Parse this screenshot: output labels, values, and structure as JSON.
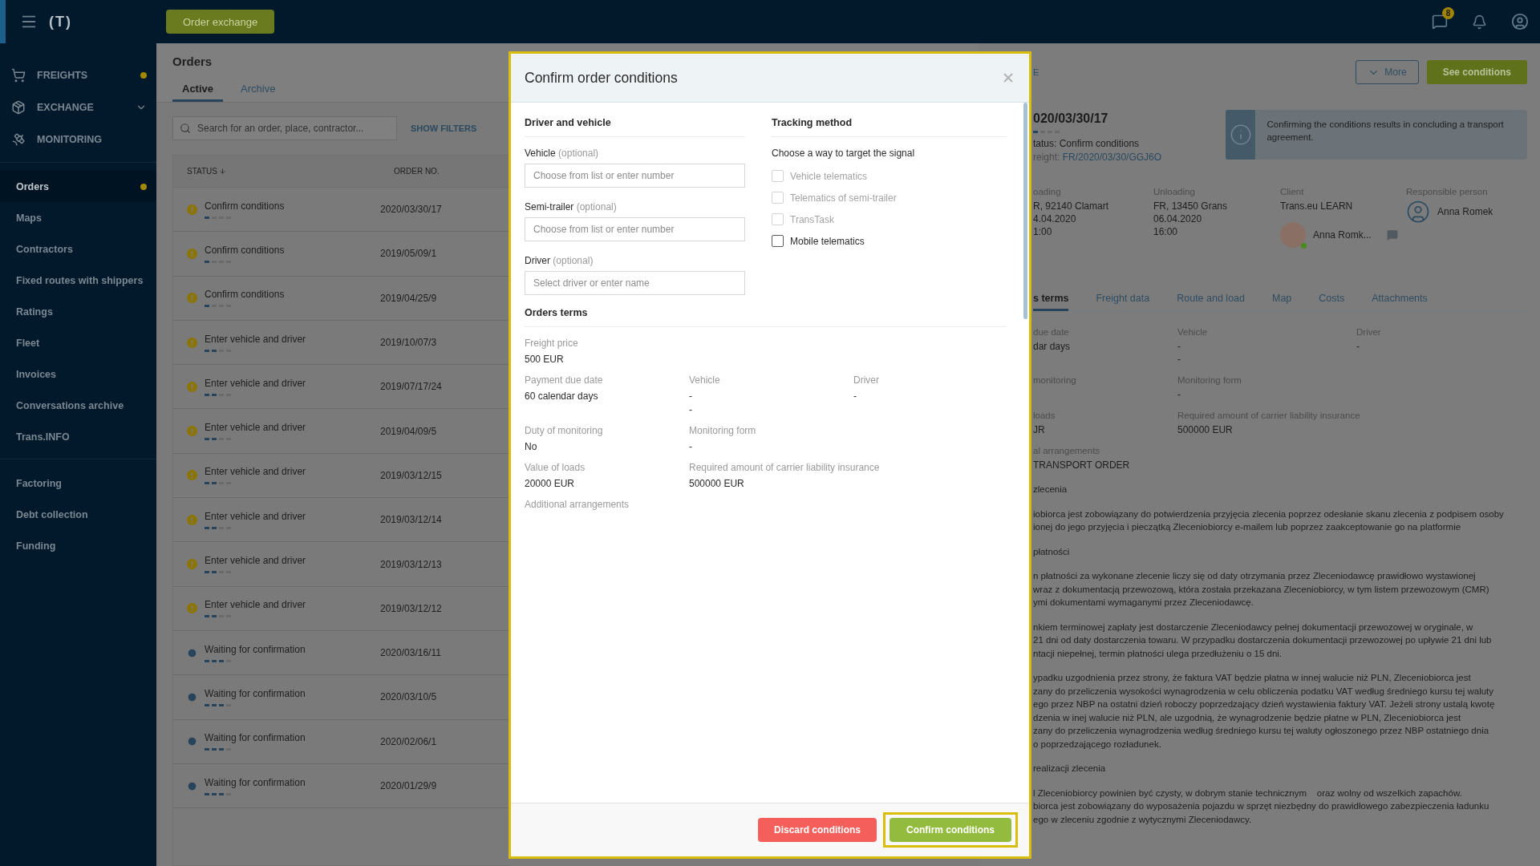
{
  "top_bar": {
    "logo": "(T)",
    "order_exchange_button": "Order exchange",
    "chat_badge": "8"
  },
  "sidebar": {
    "main_items": [
      {
        "label": "FREIGHTS",
        "dot": true,
        "expandable": false
      },
      {
        "label": "EXCHANGE",
        "dot": false,
        "expandable": true
      },
      {
        "label": "MONITORING",
        "dot": false,
        "expandable": false
      }
    ],
    "nav_items": [
      {
        "label": "Orders",
        "selected": true,
        "dot": true
      },
      {
        "label": "Maps",
        "selected": false,
        "dot": false
      },
      {
        "label": "Contractors",
        "selected": false,
        "dot": false
      },
      {
        "label": "Fixed routes with shippers",
        "selected": false,
        "dot": false
      },
      {
        "label": "Ratings",
        "selected": false,
        "dot": false
      },
      {
        "label": "Fleet",
        "selected": false,
        "dot": false
      },
      {
        "label": "Invoices",
        "selected": false,
        "dot": false
      },
      {
        "label": "Conversations archive",
        "selected": false,
        "dot": false
      },
      {
        "label": "Trans.INFO",
        "selected": false,
        "dot": false
      }
    ],
    "finance_items": [
      {
        "label": "Factoring",
        "selected": false,
        "dot": false
      },
      {
        "label": "Debt collection",
        "selected": false,
        "dot": false
      },
      {
        "label": "Funding",
        "selected": false,
        "dot": false
      }
    ]
  },
  "orders": {
    "title": "Orders",
    "tabs": [
      {
        "label": "Active",
        "selected": true
      },
      {
        "label": "Archive",
        "selected": false
      }
    ],
    "search": {
      "placeholder": "Search for an order, place, contractor..."
    },
    "show_filters": "SHOW FILTERS",
    "columns": [
      "STATUS",
      "ORDER NO."
    ],
    "rows": [
      {
        "status": "Confirm conditions",
        "kind": "warning",
        "level": 0.25,
        "order_no": "2020/03/30/17"
      },
      {
        "status": "Confirm conditions",
        "kind": "warning",
        "level": 0.25,
        "order_no": "2019/05/09/1"
      },
      {
        "status": "Confirm conditions",
        "kind": "warning",
        "level": 0.25,
        "order_no": "2019/04/25/9"
      },
      {
        "status": "Enter vehicle and driver",
        "kind": "warning",
        "level": 0.5,
        "order_no": "2019/10/07/3"
      },
      {
        "status": "Enter vehicle and driver",
        "kind": "warning",
        "level": 0.5,
        "order_no": "2019/07/17/24"
      },
      {
        "status": "Enter vehicle and driver",
        "kind": "warning",
        "level": 0.5,
        "order_no": "2019/04/09/5"
      },
      {
        "status": "Enter vehicle and driver",
        "kind": "warning",
        "level": 0.5,
        "order_no": "2019/03/12/15"
      },
      {
        "status": "Enter vehicle and driver",
        "kind": "warning",
        "level": 0.5,
        "order_no": "2019/03/12/14"
      },
      {
        "status": "Enter vehicle and driver",
        "kind": "warning",
        "level": 0.5,
        "order_no": "2019/03/12/13"
      },
      {
        "status": "Enter vehicle and driver",
        "kind": "warning",
        "level": 0.5,
        "order_no": "2019/03/12/12"
      },
      {
        "status": "Waiting for confirmation",
        "kind": "waiting",
        "level": 0.75,
        "order_no": "2020/03/16/11"
      },
      {
        "status": "Waiting for confirmation",
        "kind": "waiting",
        "level": 0.75,
        "order_no": "2020/03/10/5"
      },
      {
        "status": "Waiting for confirmation",
        "kind": "waiting",
        "level": 0.75,
        "order_no": "2020/02/06/1"
      },
      {
        "status": "Waiting for confirmation",
        "kind": "waiting",
        "level": 0.75,
        "order_no": "2020/01/29/9"
      }
    ]
  },
  "detail": {
    "breadcrumb": "E",
    "buttons": {
      "more": "More",
      "see_conditions": "See conditions"
    },
    "order_no": "020/03/30/17",
    "progress": {
      "level": 0.25
    },
    "status": "tatus: Confirm conditions",
    "freight_label": "reight:",
    "freight_link": "FR/2020/03/30/GGJ6O",
    "info": "Confirming the conditions results in concluding a transport agreement.",
    "loading": {
      "label": "oading",
      "lines": [
        "R, 92140 Clamart",
        "4.04.2020",
        "1:00"
      ]
    },
    "unloading": {
      "label": "Unloading",
      "lines": [
        "FR, 13450 Grans",
        "06.04.2020",
        "16:00"
      ]
    },
    "client": {
      "label": "Client",
      "name": "Trans.eu LEARN",
      "contact": "Anna Romk..."
    },
    "responsible": {
      "label": "Responsible person",
      "name": "Anna Romek"
    },
    "tabs": [
      {
        "label": "s terms",
        "selected": true
      },
      {
        "label": "Freight data",
        "selected": false
      },
      {
        "label": "Route and load",
        "selected": false
      },
      {
        "label": "Map",
        "selected": false
      },
      {
        "label": "Costs",
        "selected": false
      },
      {
        "label": "Attachments",
        "selected": false
      }
    ],
    "terms": [
      [
        {
          "label": "due date",
          "values": [
            "dar days"
          ]
        },
        {
          "label": "Vehicle",
          "values": [
            "-",
            "-"
          ]
        },
        {
          "label": "Driver",
          "values": [
            "-"
          ]
        }
      ],
      [
        {
          "label": "monitoring"
        },
        {
          "label": "Monitoring form",
          "values": [
            "-"
          ]
        }
      ],
      [
        {
          "label": "loads",
          "values": [
            "JR"
          ]
        },
        {
          "label": "Required amount of carrier liability insurance",
          "values": [
            "500000 EUR"
          ]
        }
      ],
      [
        {
          "label": "al arrangements",
          "values": [
            "TRANSPORT ORDER"
          ]
        }
      ]
    ],
    "paragraphs": [
      [
        "zlecenia"
      ],
      [
        "iobiorca jest zobowiązany do potwierdzenia przyjęcia zlecenia poprzez odesłanie skanu zlecenia z podpisem osoby",
        "ionej do jego przyjęcia i pieczątką Zleceniobiorcy e-mailem lub poprzez zaakceptowanie go na platformie"
      ],
      [
        "płatności"
      ],
      [
        "n płatności za wykonane zlecenie liczy się od daty otrzymania przez Zleceniodawcę prawidłowo wystawionej",
        "wraz z dokumentacją przewozową, która została przekazana Zleceniobiorcy, w tym listem przewozowym (CMR)",
        "ymi dokumentami wymaganymi przez Zleceniodawcę."
      ],
      [
        "nkiem terminowej zapłaty jest dostarczenie Zleceniodawcy pełnej dokumentacji przewozowej w oryginale, w",
        "21 dni od daty dostarczenia towaru. W przypadku dostarczenia dokumentacji przewozowej po upływie 21 dni lub",
        "ntacji niepełnej, termin płatności ulega przedłużeniu o 15 dni."
      ],
      [
        "ypadku uzgodnienia przez strony, że faktura VAT będzie płatna w innej walucie niż PLN, Zleceniobiorca jest",
        "zany do przeliczenia wysokości wynagrodzenia w celu obliczenia podatku VAT według średniego kursu tej waluty",
        "ego przez NBP na ostatni dzień roboczy poprzedzający dzień wystawienia faktury VAT. Jeżeli strony ustalą kwotę",
        "dzenia w inej walucie niż PLN, ale uzgodnią, że wynagrodzenie będzie płatne w PLN, Zleceniobiorca jest",
        "zany do przeliczenia wynagrodzenia według średniego kursu tej waluty ogłoszonego przez NBP ostatniego dnia",
        "o poprzedzającego rozładunek."
      ],
      [
        "realizacji zlecenia"
      ],
      [
        "l Zleceniobiorcy powinien być czysty, w dobrym stanie technicznym    oraz wolny od wszelkich zapachów.",
        "biorca jest zobowiązany do wyposażenia pojazdu w sprzęt niezbędny do prawidłowego zabezpieczenia ładunku",
        "ego w zleceniu zgodnie z wytycznymi Zleceniodawcy."
      ]
    ]
  },
  "modal": {
    "title": "Confirm order conditions",
    "driver_section": {
      "title": "Driver and vehicle",
      "fields": [
        {
          "label": "Vehicle",
          "hint": "(optional)",
          "placeholder": "Choose from list or enter number"
        },
        {
          "label": "Semi-trailer",
          "hint": "(optional)",
          "placeholder": "Choose from list or enter number"
        },
        {
          "label": "Driver",
          "hint": "(optional)",
          "placeholder": "Select driver or enter name"
        }
      ]
    },
    "tracking": {
      "title": "Tracking method",
      "prompt": "Choose a way to target the signal",
      "options": [
        {
          "label": "Vehicle telematics",
          "checked": false,
          "disabled": true
        },
        {
          "label": "Telematics of semi-trailer",
          "checked": false,
          "disabled": true
        },
        {
          "label": "TransTask",
          "checked": false,
          "disabled": true
        },
        {
          "label": "Mobile telematics",
          "checked": false,
          "disabled": false
        }
      ]
    },
    "terms": {
      "title": "Orders terms",
      "rows": [
        [
          {
            "label": "Freight price",
            "values": [
              "500 EUR"
            ]
          }
        ],
        [
          {
            "label": "Payment due date",
            "values": [
              "60 calendar days"
            ]
          },
          {
            "label": "Vehicle",
            "values": [
              "-",
              "-"
            ]
          },
          {
            "label": "Driver",
            "values": [
              "-"
            ]
          }
        ],
        [
          {
            "label": "Duty of monitoring",
            "values": [
              "No"
            ]
          },
          {
            "label": "Monitoring form",
            "values": [
              "-"
            ]
          }
        ],
        [
          {
            "label": "Value of loads",
            "values": [
              "20000 EUR"
            ]
          },
          {
            "label": "Required amount of carrier liability insurance",
            "values": [
              "500000 EUR"
            ]
          }
        ],
        [
          {
            "label": "Additional arrangements"
          }
        ]
      ]
    },
    "buttons": {
      "discard": "Discard conditions",
      "confirm": "Confirm conditions"
    }
  }
}
